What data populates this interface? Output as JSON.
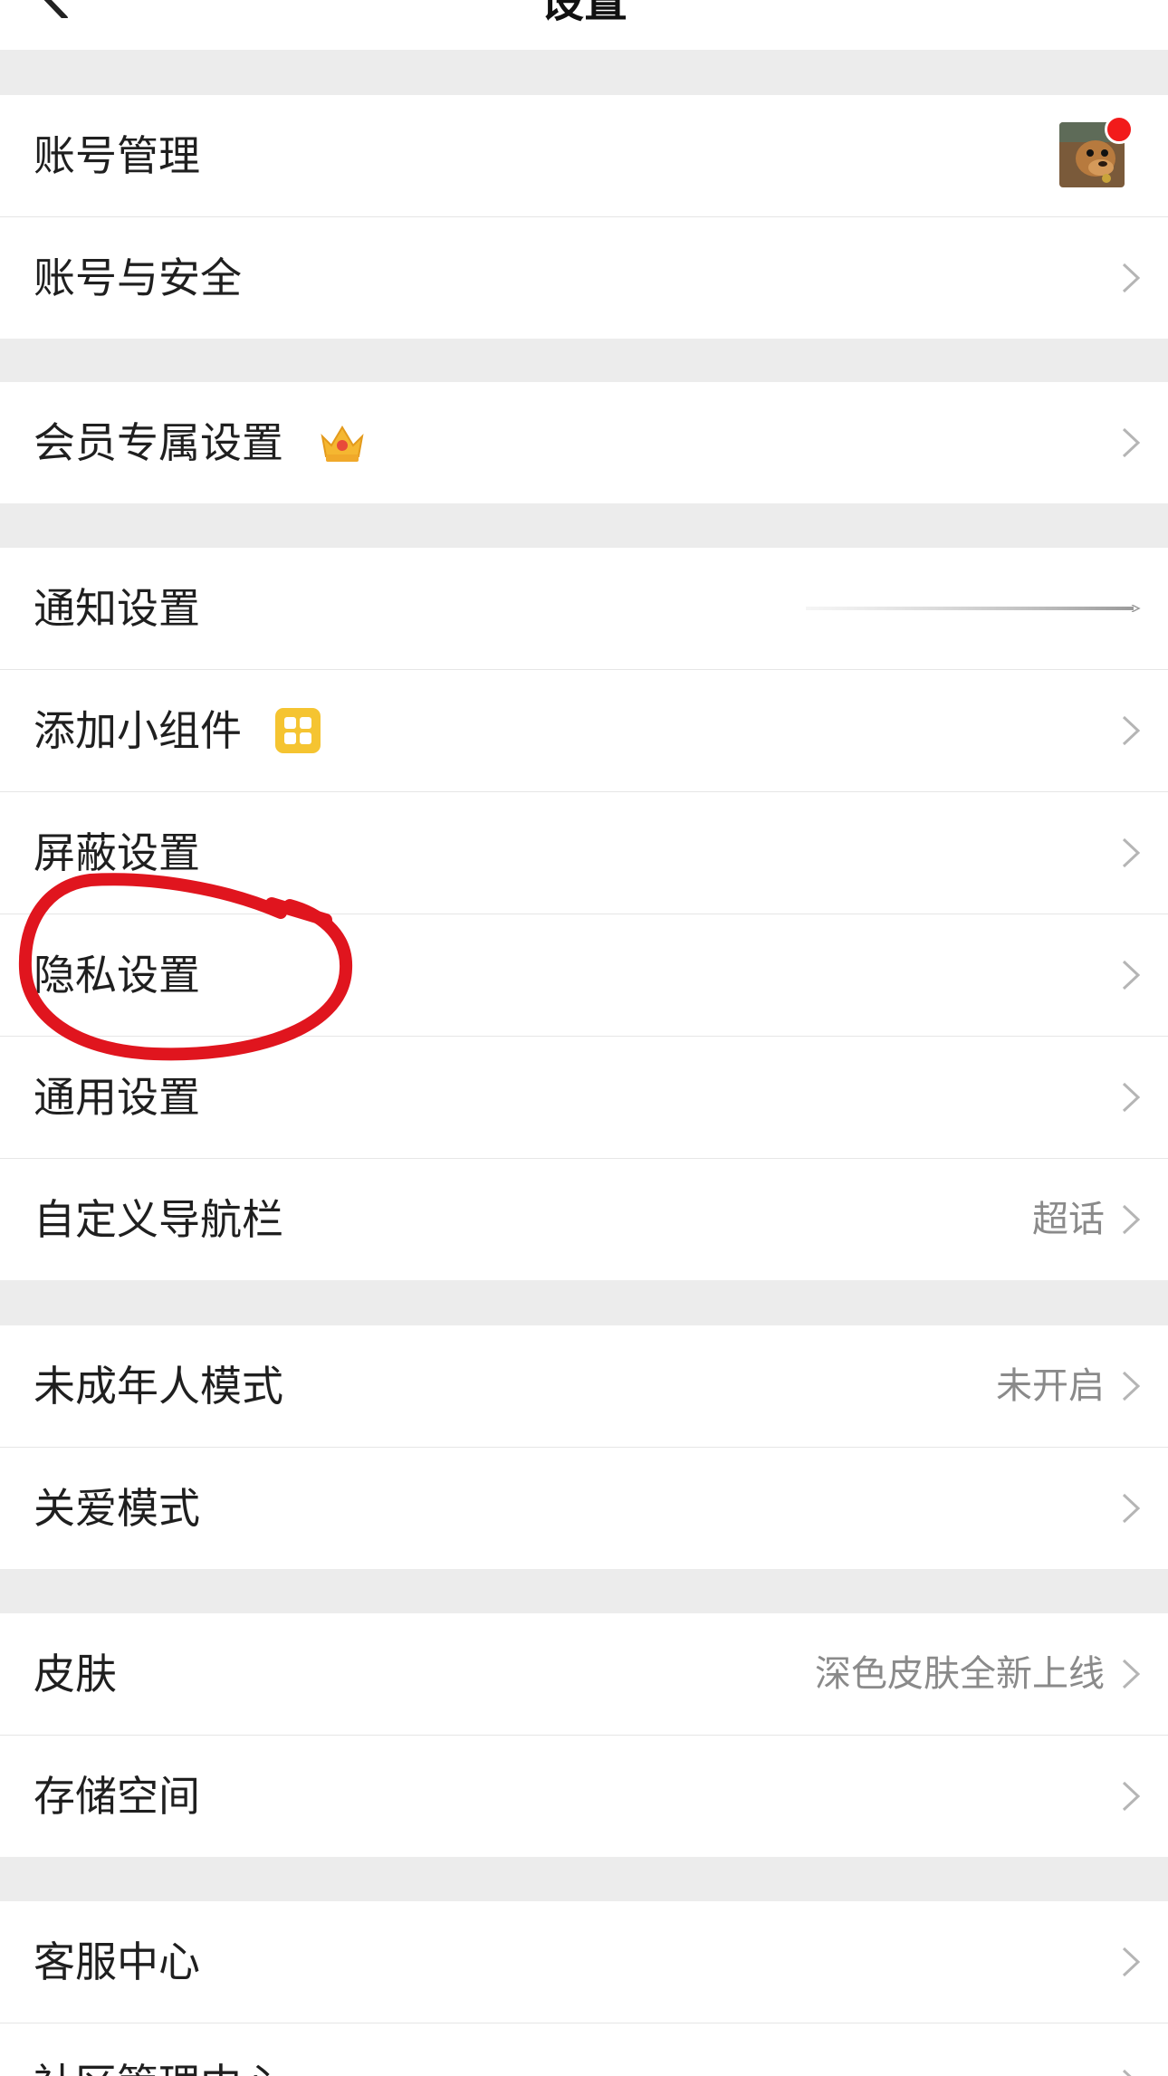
{
  "header": {
    "title": "设置"
  },
  "sections": [
    {
      "rows": [
        {
          "label": "账号管理",
          "value": ""
        },
        {
          "label": "账号与安全",
          "value": ""
        }
      ]
    },
    {
      "rows": [
        {
          "label": "会员专属设置",
          "value": ""
        }
      ]
    },
    {
      "rows": [
        {
          "label": "通知设置",
          "value": ""
        },
        {
          "label": "添加小组件",
          "value": ""
        },
        {
          "label": "屏蔽设置",
          "value": ""
        },
        {
          "label": "隐私设置",
          "value": ""
        },
        {
          "label": "通用设置",
          "value": ""
        },
        {
          "label": "自定义导航栏",
          "value": "超话"
        }
      ]
    },
    {
      "rows": [
        {
          "label": "未成年人模式",
          "value": "未开启"
        },
        {
          "label": "关爱模式",
          "value": ""
        }
      ]
    },
    {
      "rows": [
        {
          "label": "皮肤",
          "value": "深色皮肤全新上线"
        },
        {
          "label": "存储空间",
          "value": ""
        }
      ]
    },
    {
      "rows": [
        {
          "label": "客服中心",
          "value": ""
        },
        {
          "label": "社区管理中心",
          "value": ""
        }
      ]
    }
  ],
  "icons": {
    "back": "back-arrow-icon",
    "chevron": "chevron-right-icon",
    "crown": "crown-icon",
    "widget": "widget-grid-icon"
  },
  "colors": {
    "background": "#ececec",
    "row_bg": "#ffffff",
    "text": "#1f1f1f",
    "secondary_text": "#8a8a8a",
    "chevron": "#b5b5b5",
    "notification_dot": "#f21b1b",
    "annotation_red": "#e0151e",
    "accent_yellow": "#f5c431"
  }
}
